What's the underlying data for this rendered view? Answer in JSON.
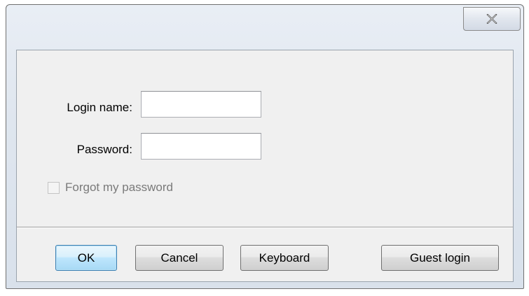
{
  "window": {
    "title": "",
    "close_icon": "close-icon"
  },
  "form": {
    "login_label": "Login name:",
    "login_value": "",
    "password_label": "Password:",
    "password_value": "",
    "forgot_label": "Forgot my password",
    "forgot_checked": false,
    "forgot_enabled": false
  },
  "buttons": {
    "ok_label": "OK",
    "cancel_label": "Cancel",
    "keyboard_label": "Keyboard",
    "guest_label": "Guest login"
  },
  "colors": {
    "default_button_border": "#3c7fb1",
    "disabled_text": "#7a7a7a"
  }
}
